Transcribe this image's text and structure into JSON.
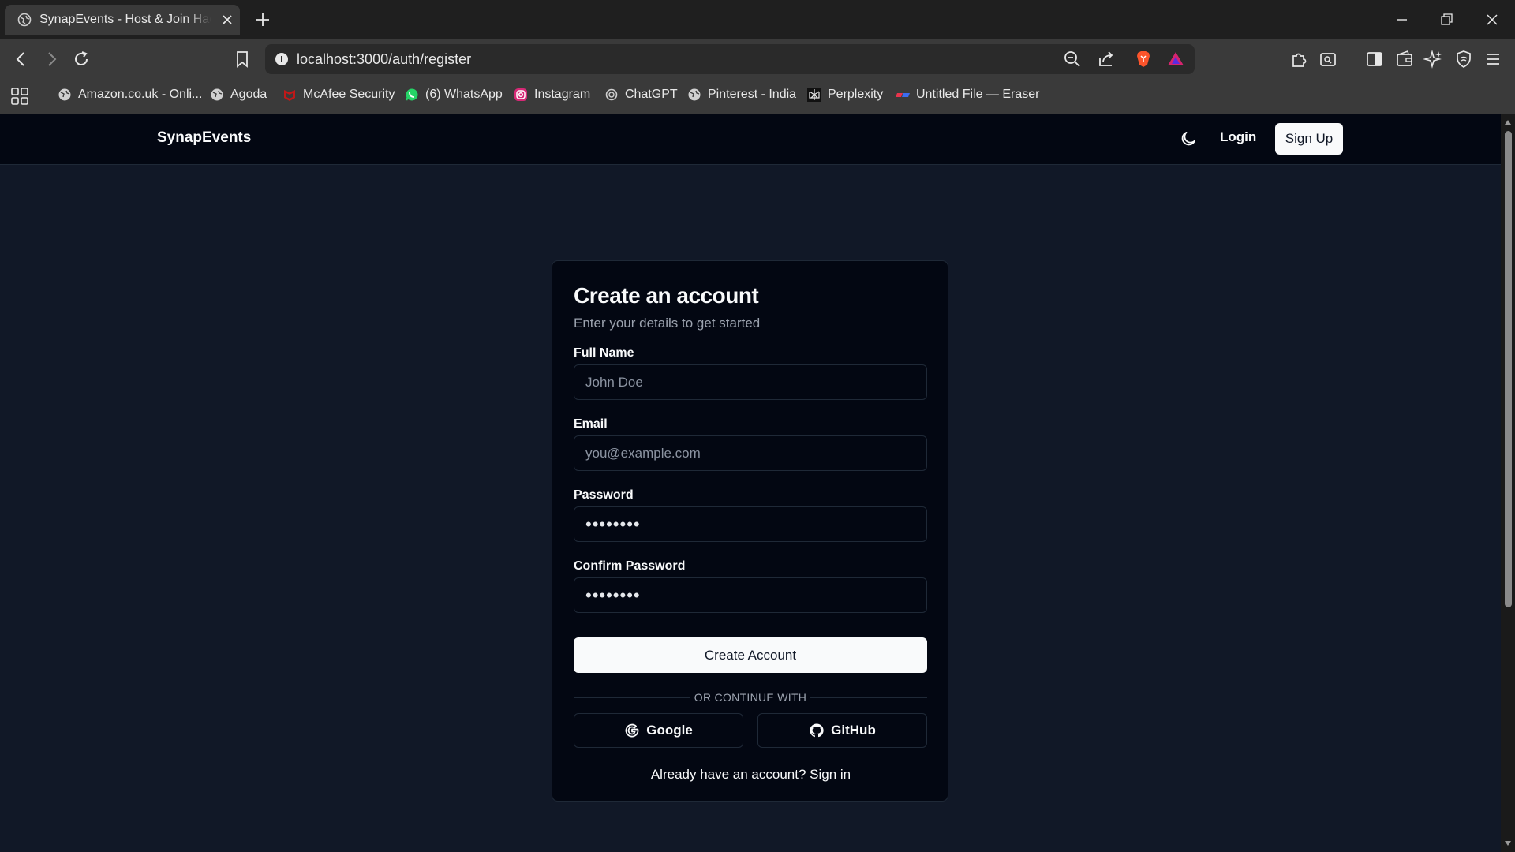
{
  "browser": {
    "tab_title": "SynapEvents - Host & Join Hackathons",
    "url": "localhost:3000/auth/register",
    "bookmarks": [
      {
        "label": "Amazon.co.uk - Onli...",
        "icon": "globe-icon"
      },
      {
        "label": "Agoda",
        "icon": "globe-icon"
      },
      {
        "label": "McAfee Security",
        "icon": "mcafee-icon"
      },
      {
        "label": "(6) WhatsApp",
        "icon": "whatsapp-icon"
      },
      {
        "label": "Instagram",
        "icon": "instagram-icon"
      },
      {
        "label": "ChatGPT",
        "icon": "chatgpt-icon"
      },
      {
        "label": "Pinterest - India",
        "icon": "globe-icon"
      },
      {
        "label": "Perplexity",
        "icon": "perplexity-icon"
      },
      {
        "label": "Untitled File — Eraser",
        "icon": "eraser-icon"
      }
    ]
  },
  "nav": {
    "brand": "SynapEvents",
    "login": "Login",
    "signup": "Sign Up"
  },
  "form": {
    "title": "Create an account",
    "subtitle": "Enter your details to get started",
    "fullname_label": "Full Name",
    "fullname_placeholder": "John Doe",
    "email_label": "Email",
    "email_placeholder": "you@example.com",
    "password_label": "Password",
    "password_value": "••••••••",
    "confirm_label": "Confirm Password",
    "confirm_value": "••••••••",
    "submit": "Create Account",
    "divider": "OR CONTINUE WITH",
    "google": "Google",
    "github": "GitHub",
    "already": "Already have an account? Sign in"
  },
  "colors": {
    "page_bg": "#111827",
    "nav_bg": "#030712",
    "card_bg": "#030712",
    "border": "#1f2937",
    "primary_button": "#f9fafb"
  }
}
